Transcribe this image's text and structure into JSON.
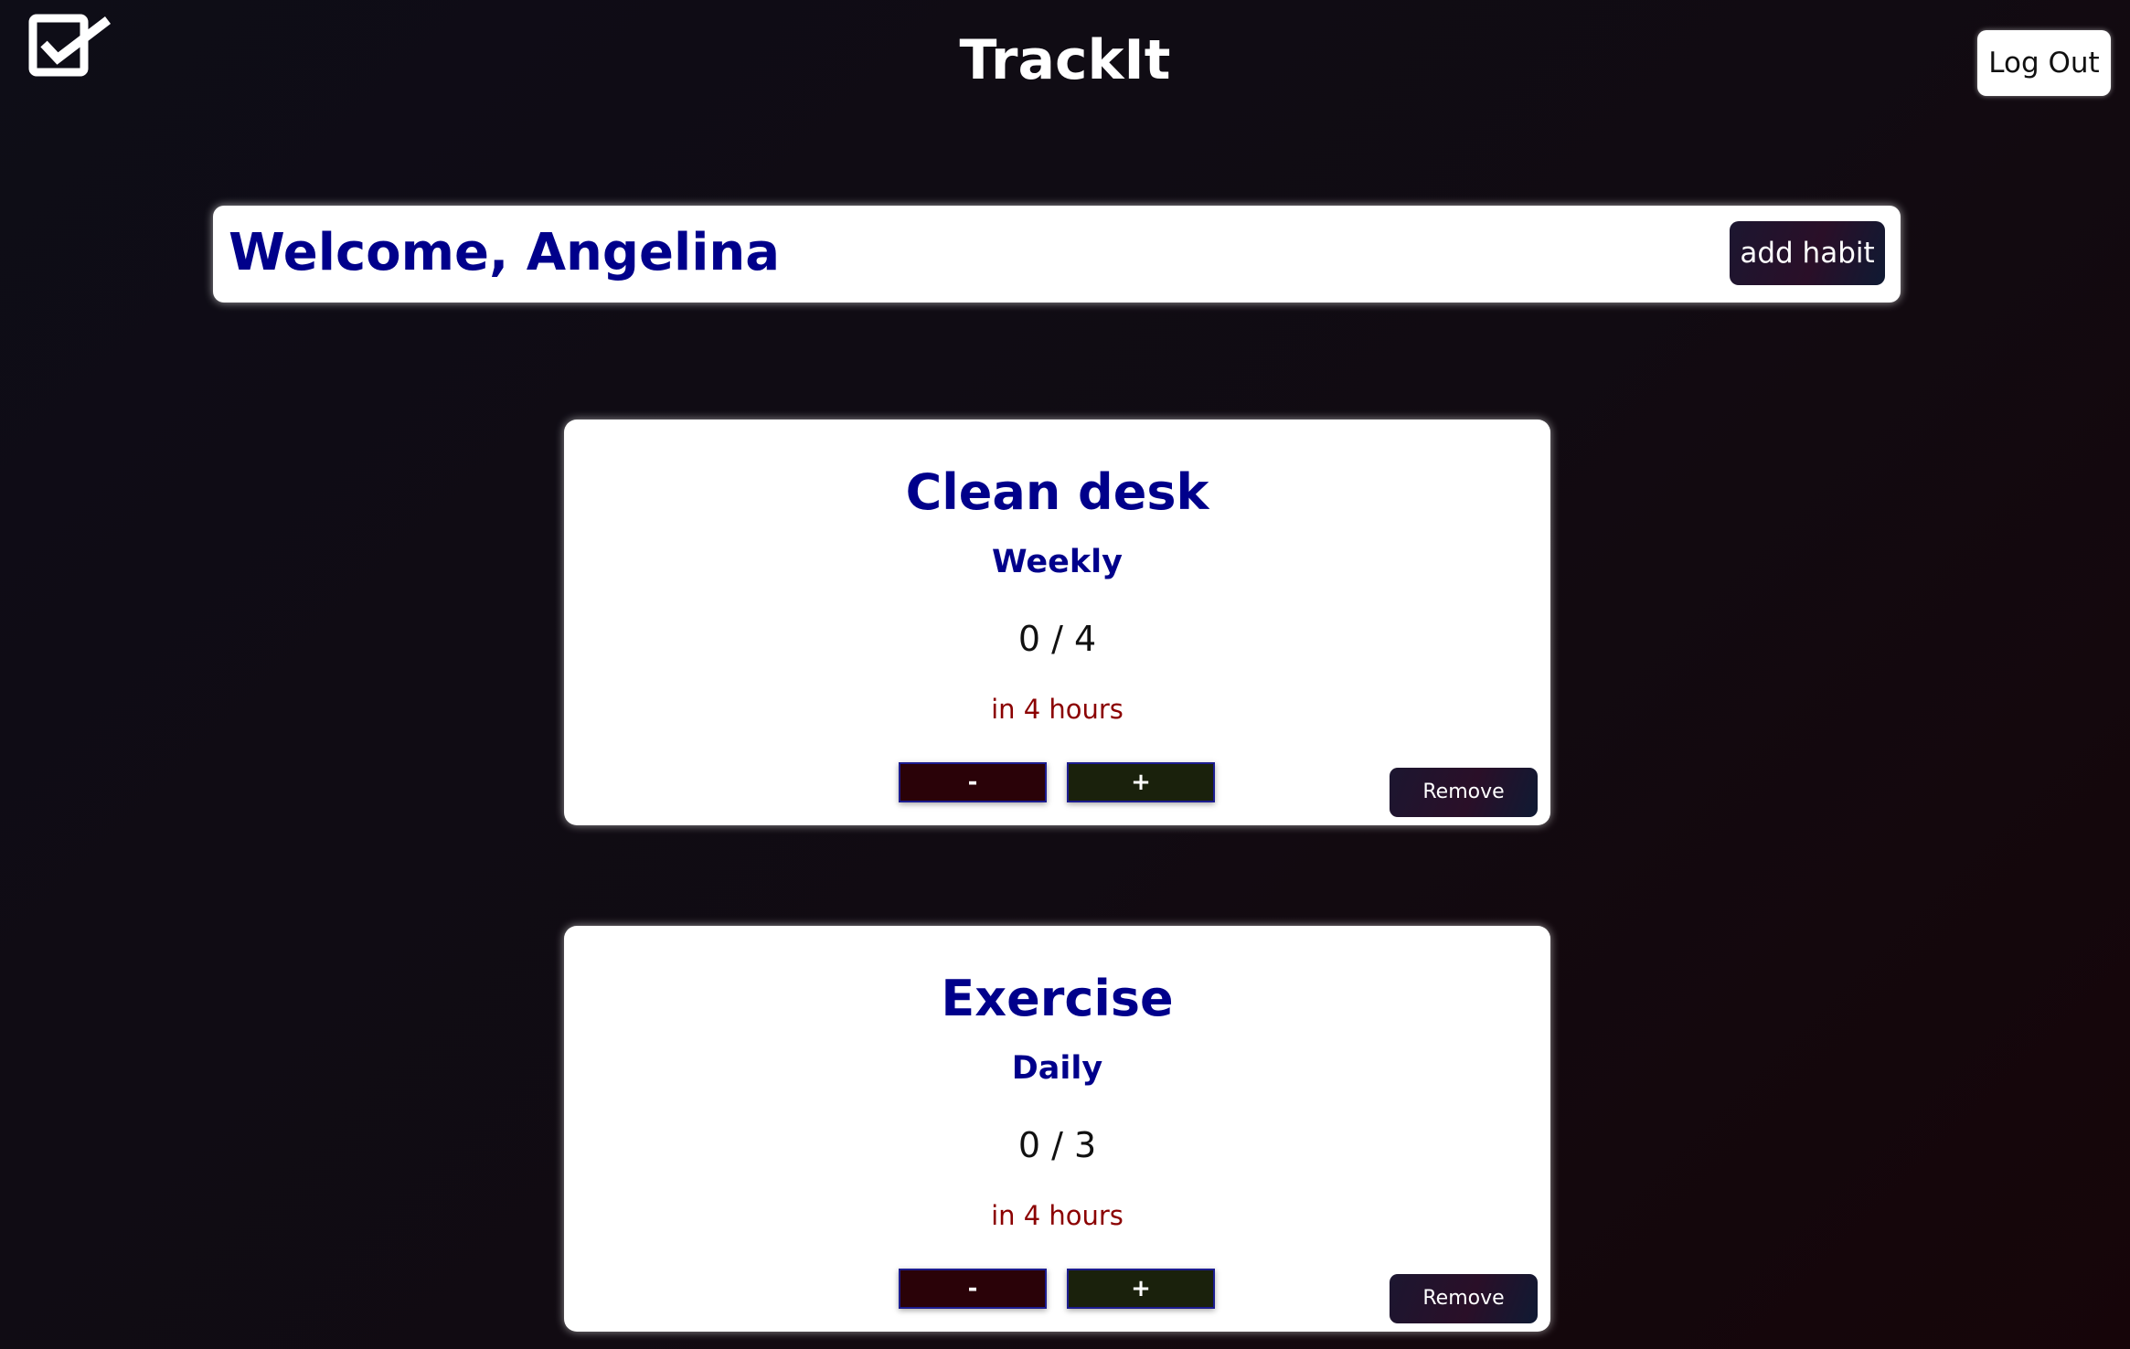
{
  "header": {
    "logo_icon": "checkbox-check-icon",
    "app_title": "TrackIt",
    "logout_label": "Log Out"
  },
  "welcome": {
    "text": "Welcome, Angelina",
    "add_habit_label": "add habit"
  },
  "habits": [
    {
      "name": "Clean desk",
      "frequency": "Weekly",
      "progress": "0 / 4",
      "due": "in 4 hours",
      "decrement_label": "-",
      "increment_label": "+",
      "remove_label": "Remove"
    },
    {
      "name": "Exercise",
      "frequency": "Daily",
      "progress": "0 / 3",
      "due": "in 4 hours",
      "decrement_label": "-",
      "increment_label": "+",
      "remove_label": "Remove"
    }
  ],
  "colors": {
    "title_blue": "#00008b",
    "due_red": "#8b0000",
    "decrement_bg": "#2a0208",
    "increment_bg": "#1a210c"
  }
}
